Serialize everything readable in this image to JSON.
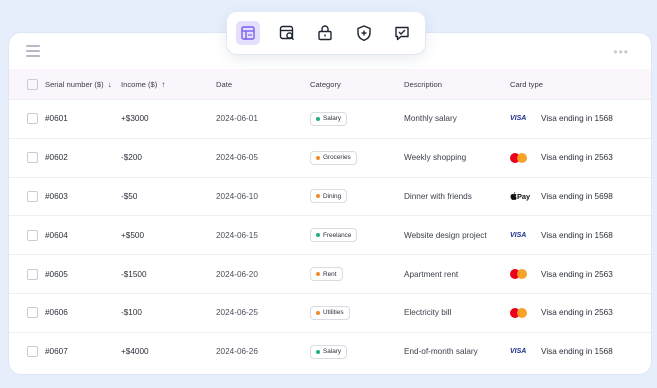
{
  "table": {
    "columns": {
      "serial": "Serial number ($)",
      "income": "Income ($)",
      "date": "Date",
      "category": "Category",
      "description": "Description",
      "card_type": "Card type"
    },
    "rows": [
      {
        "serial": "#0601",
        "income": "+$3000",
        "date": "2024-06-01",
        "category": "Salary",
        "category_color": "#22b07d",
        "description": "Monthly salary",
        "brand": "visa",
        "brand_label": "VISA",
        "card": "Visa ending in 1568"
      },
      {
        "serial": "#0602",
        "income": "-$200",
        "date": "2024-06-05",
        "category": "Groceries",
        "category_color": "#f28a2e",
        "description": "Weekly shopping",
        "brand": "mastercard",
        "brand_label": "",
        "card": "Visa ending in 2563"
      },
      {
        "serial": "#0603",
        "income": "-$50",
        "date": "2024-06-10",
        "category": "Dining",
        "category_color": "#f28a2e",
        "description": "Dinner with friends",
        "brand": "applepay",
        "brand_label": "Pay",
        "card": "Visa ending in 5698"
      },
      {
        "serial": "#0604",
        "income": "+$500",
        "date": "2024-06-15",
        "category": "Freelance",
        "category_color": "#22b07d",
        "description": "Website design project",
        "brand": "visa",
        "brand_label": "VISA",
        "card": "Visa ending in 1568"
      },
      {
        "serial": "#0605",
        "income": "-$1500",
        "date": "2024-06-20",
        "category": "Rent",
        "category_color": "#f28a2e",
        "description": "Apartment rent",
        "brand": "mastercard",
        "brand_label": "",
        "card": "Visa ending in 2563"
      },
      {
        "serial": "#0606",
        "income": "-$100",
        "date": "2024-06-25",
        "category": "Utilities",
        "category_color": "#f28a2e",
        "description": "Electricity bill",
        "brand": "mastercard",
        "brand_label": "",
        "card": "Visa ending in 2563"
      },
      {
        "serial": "#0607",
        "income": "+$4000",
        "date": "2024-06-26",
        "category": "Salary",
        "category_color": "#22b07d",
        "description": "End-of-month salary",
        "brand": "visa",
        "brand_label": "VISA",
        "card": "Visa ending in 1568"
      }
    ]
  },
  "toolbar": {
    "tools": [
      "table-layout-icon",
      "table-search-icon",
      "lock-icon",
      "shield-plus-icon",
      "message-check-icon"
    ],
    "active": "table-layout-icon",
    "accent": "#7a5cf0"
  },
  "topbar": {
    "dots": "•••"
  }
}
